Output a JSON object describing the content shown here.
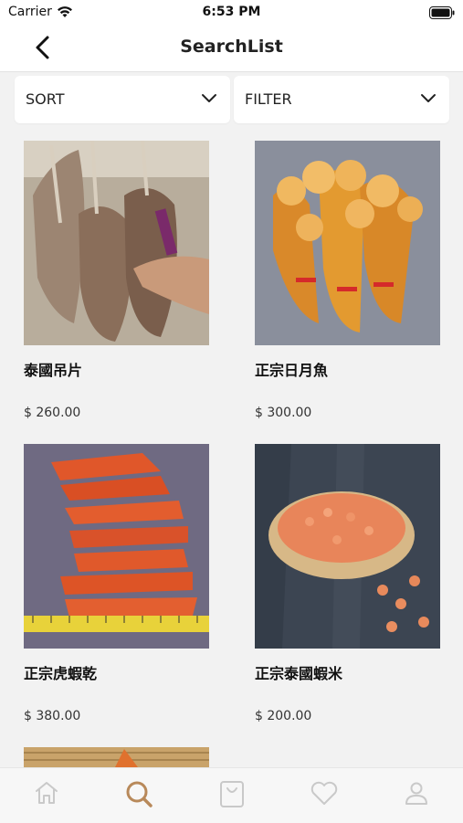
{
  "status": {
    "carrier": "Carrier",
    "time": "6:53 PM"
  },
  "nav": {
    "title": "SearchList"
  },
  "controls": {
    "sort_label": "SORT",
    "filter_label": "FILTER"
  },
  "products": [
    {
      "name": "泰國吊片",
      "price": "$ 260.00"
    },
    {
      "name": "正宗日月魚",
      "price": "$ 300.00"
    },
    {
      "name": "正宗虎蝦乾",
      "price": "$ 380.00"
    },
    {
      "name": "正宗泰國蝦米",
      "price": "$ 200.00"
    }
  ],
  "tabs": [
    {
      "icon": "home-icon"
    },
    {
      "icon": "search-icon",
      "active": true
    },
    {
      "icon": "cart-bag-icon"
    },
    {
      "icon": "heart-icon"
    },
    {
      "icon": "profile-icon"
    }
  ],
  "colors": {
    "accent": "#b8895a",
    "tab_inactive": "#c9c9c9",
    "background": "#f2f2f2"
  }
}
